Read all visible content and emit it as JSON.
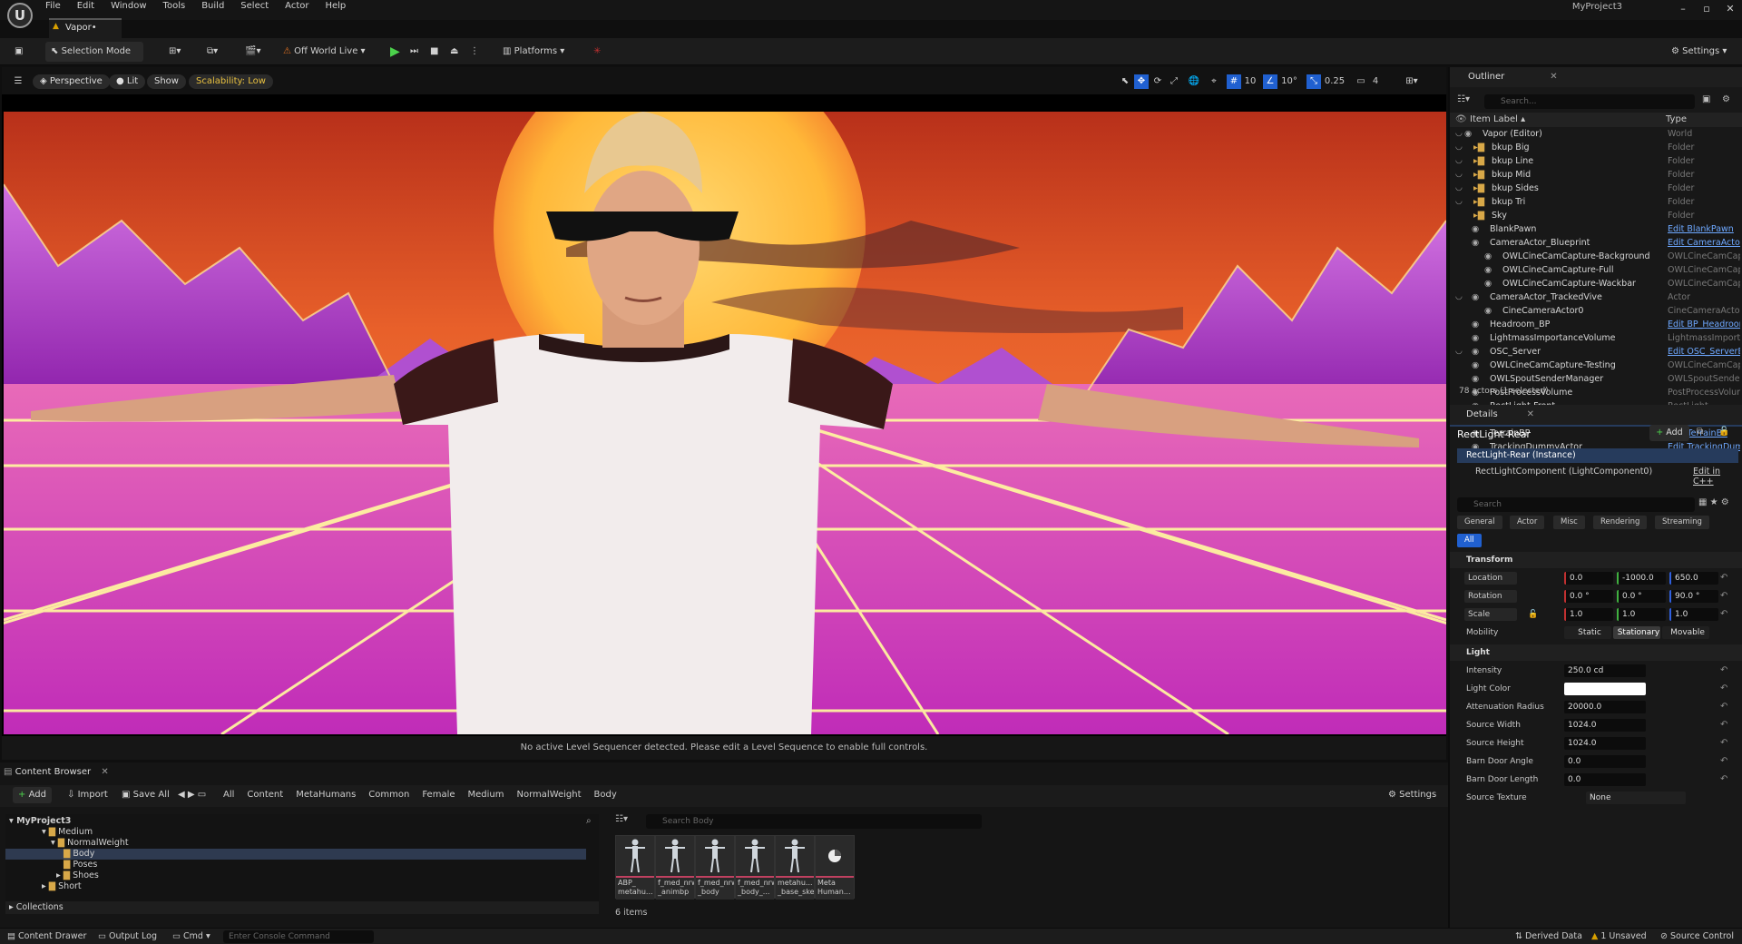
{
  "app": {
    "menu": [
      "File",
      "Edit",
      "Window",
      "Tools",
      "Build",
      "Select",
      "Actor",
      "Help"
    ],
    "project": "MyProject3",
    "level_tab": "Vapor•"
  },
  "toolbar": {
    "selection_mode": "Selection Mode",
    "world": "Off World Live",
    "platforms": "Platforms",
    "settings": "Settings"
  },
  "viewport": {
    "perspective": "Perspective",
    "lit": "Lit",
    "show": "Show",
    "scalability": "Scalability: Low",
    "grid": "10",
    "rot": "10°",
    "scale": "0.25",
    "cam": "4",
    "message": "No active Level Sequencer detected. Please edit a Level Sequence to enable full controls."
  },
  "outliner": {
    "title": "Outliner",
    "search": "Search...",
    "col_label": "Item Label ▴",
    "col_type": "Type",
    "status": "78 actors (1 selected)",
    "rows": [
      {
        "label": "Vapor (Editor)",
        "type": "World",
        "link": false
      },
      {
        "label": "bkup Big",
        "type": "Folder",
        "link": false
      },
      {
        "label": "bkup Line",
        "type": "Folder",
        "link": false
      },
      {
        "label": "bkup Mid",
        "type": "Folder",
        "link": false
      },
      {
        "label": "bkup Sides",
        "type": "Folder",
        "link": false
      },
      {
        "label": "bkup Tri",
        "type": "Folder",
        "link": false
      },
      {
        "label": "Sky",
        "type": "Folder",
        "link": false
      },
      {
        "label": "BlankPawn",
        "type": "Edit BlankPawn",
        "link": true
      },
      {
        "label": "CameraActor_Blueprint",
        "type": "Edit CameraActor_",
        "link": true
      },
      {
        "label": "OWLCineCamCapture-Background",
        "type": "OWLCineCamCaptu",
        "link": false
      },
      {
        "label": "OWLCineCamCapture-Full",
        "type": "OWLCineCamCaptu",
        "link": false
      },
      {
        "label": "OWLCineCamCapture-Wackbar",
        "type": "OWLCineCamCaptu",
        "link": false
      },
      {
        "label": "CameraActor_TrackedVive",
        "type": "Actor",
        "link": false
      },
      {
        "label": "CineCameraActor0",
        "type": "CineCameraActor",
        "link": false
      },
      {
        "label": "Headroom_BP",
        "type": "Edit BP_Headroom",
        "link": true
      },
      {
        "label": "LightmassImportanceVolume",
        "type": "LightmassImportar",
        "link": false
      },
      {
        "label": "OSC_Server",
        "type": "Edit OSC_ServerBl",
        "link": true
      },
      {
        "label": "OWLCineCamCapture-Testing",
        "type": "OWLCineCamCaptu",
        "link": false
      },
      {
        "label": "OWLSpoutSenderManager",
        "type": "OWLSpoutSenderM",
        "link": false
      },
      {
        "label": "PostProcessVolume",
        "type": "PostProcessVolum",
        "link": false
      },
      {
        "label": "RectLight-Front",
        "type": "RectLight",
        "link": false
      },
      {
        "label": "RectLight-Rear",
        "type": "RectLight",
        "link": false
      },
      {
        "label": "TerrainBP",
        "type": "Edit TerrainBP",
        "link": true
      },
      {
        "label": "TrackingDummyActor",
        "type": "Edit TrackingDumr",
        "link": true
      }
    ]
  },
  "details": {
    "title": "Details",
    "actor": "RectLight-Rear",
    "add": "Add",
    "instance": "RectLight-Rear (Instance)",
    "component": "RectLightComponent (LightComponent0)",
    "edit_cpp": "Edit in C++",
    "search": "Search",
    "filters": [
      "General",
      "Actor",
      "Misc",
      "Rendering",
      "Streaming"
    ],
    "filter_all": "All",
    "transform": "Transform",
    "location": "Location",
    "rotation": "Rotation",
    "scale": "Scale",
    "loc": [
      "0.0",
      "-1000.0",
      "650.0"
    ],
    "rot": [
      "0.0 °",
      "0.0 °",
      "90.0 °"
    ],
    "scl": [
      "1.0",
      "1.0",
      "1.0"
    ],
    "mobility": "Mobility",
    "mob": [
      "Static",
      "Stationary",
      "Movable"
    ],
    "light": "Light",
    "intensity_k": "Intensity",
    "intensity": "250.0 cd",
    "color_k": "Light Color",
    "atten_k": "Attenuation Radius",
    "atten": "20000.0",
    "sw_k": "Source Width",
    "sw": "1024.0",
    "sh_k": "Source Height",
    "sh": "1024.0",
    "bda_k": "Barn Door Angle",
    "bda": "0.0",
    "bdl_k": "Barn Door Length",
    "bdl": "0.0",
    "tex_k": "Source Texture",
    "tex": "None"
  },
  "content": {
    "tab": "Content Browser",
    "add": "Add",
    "import": "Import",
    "save": "Save All",
    "settings": "Settings",
    "crumbs": [
      "All",
      "Content",
      "MetaHumans",
      "Common",
      "Female",
      "Medium",
      "NormalWeight",
      "Body"
    ],
    "root": "MyProject3",
    "tree": [
      "Medium",
      "NormalWeight",
      "Body",
      "Poses",
      "Shoes",
      "Short"
    ],
    "collections": "Collections",
    "search": "Search Body",
    "count": "6 items",
    "assets": [
      "ABP_ metahu...",
      "f_med_nrw _animbp",
      "f_med_nrw _body",
      "f_med_nrw _body_...",
      "metahu... _base_skel",
      "Meta Human..."
    ]
  },
  "statusbar": {
    "drawer": "Content Drawer",
    "output": "Output Log",
    "cmd": "Cmd",
    "console": "Enter Console Command",
    "derived": "Derived Data",
    "unsaved": "1 Unsaved",
    "source": "Source Control"
  }
}
